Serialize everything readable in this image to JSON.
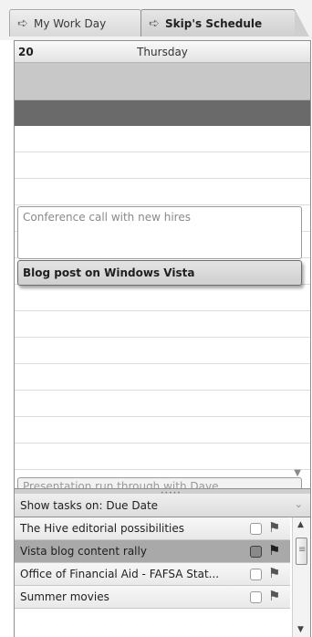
{
  "tabs": [
    {
      "label": "My Work Day",
      "icon": "arrow-right-icon"
    },
    {
      "label": "Skip's Schedule",
      "icon": "arrow-right-icon"
    }
  ],
  "calendar": {
    "date_number": "20",
    "day_name": "Thursday",
    "appointments": [
      {
        "label": "Conference call with new hires"
      },
      {
        "label": "Blog post on Windows Vista"
      },
      {
        "label": "Presentation run through with Dave"
      }
    ]
  },
  "tasks": {
    "header": "Show tasks on: Due Date",
    "items": [
      {
        "label": "The Hive editorial possibilities"
      },
      {
        "label": "Vista blog content rally"
      },
      {
        "label": "Office of Financial Aid - FAFSA Stat..."
      },
      {
        "label": "Summer movies"
      }
    ]
  }
}
